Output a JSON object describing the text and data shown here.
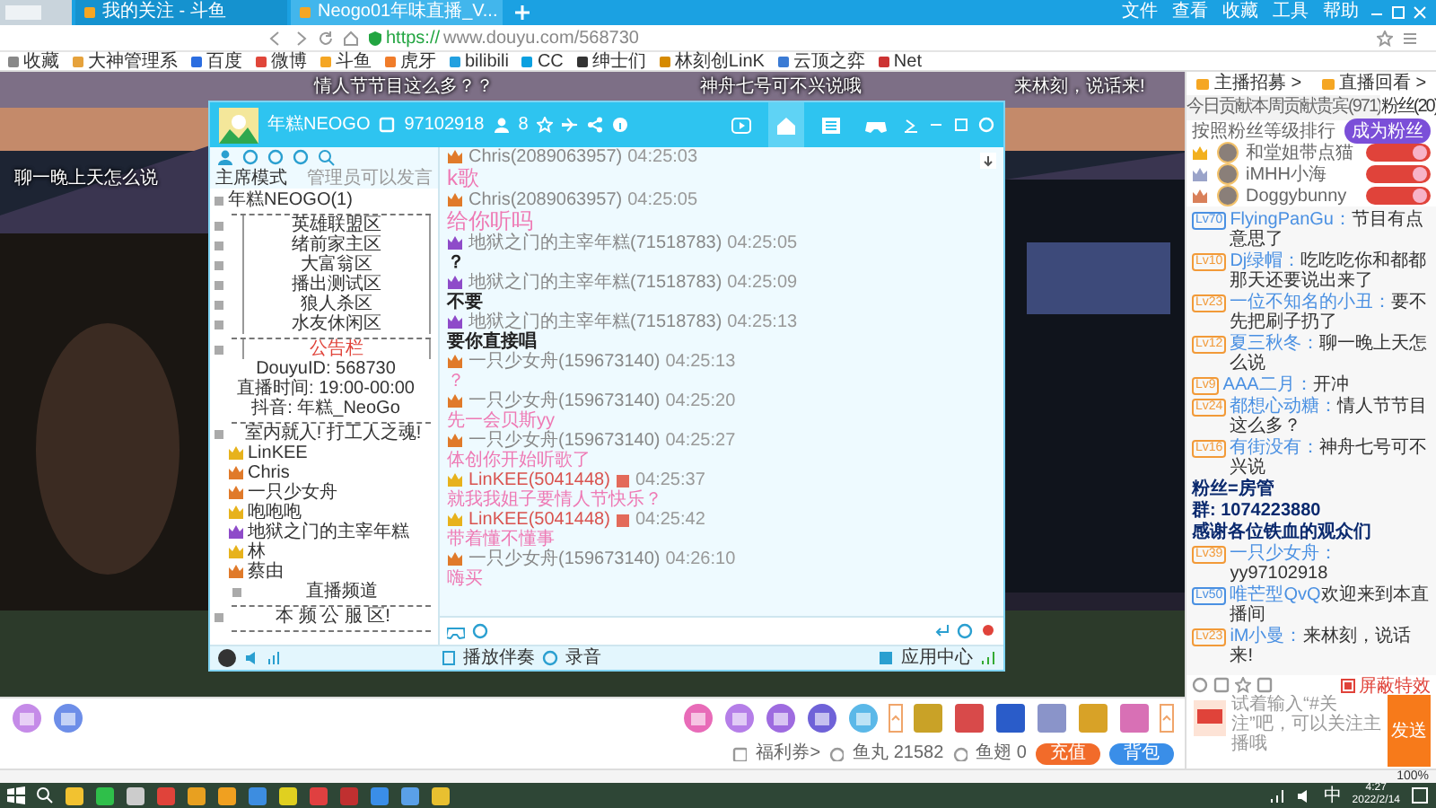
{
  "browser": {
    "tabs": [
      {
        "label": "我的关注 - 斗鱼",
        "selected": false
      },
      {
        "label": "Neogo01年味直播_V...",
        "selected": true
      }
    ],
    "menu": [
      "文件",
      "查看",
      "收藏",
      "工具",
      "帮助"
    ],
    "url_scheme": "https://",
    "url_rest": "www.douyu.com/568730",
    "bookmarks": [
      "收藏",
      "大神管理系",
      "百度",
      "微博",
      "斗鱼",
      "虎牙",
      "bilibili",
      "CC",
      "绅士们",
      "林刻创LinK",
      "云顶之弈",
      "Net"
    ]
  },
  "video": {
    "kind": "picture",
    "danmaku": [
      "情人节节目这么多？？",
      "神舟七号可不兴说哦",
      "来林刻，说话来!",
      "聊一晚上天怎么说"
    ]
  },
  "chat_app": {
    "title": "年糕NEOGO",
    "channel_id": "97102918",
    "online": "8",
    "mode": "主席模式",
    "notice": "管理员可以发言",
    "channels": [
      {
        "kind": "root",
        "label": "年糕NEOGO(1)"
      },
      {
        "kind": "divider"
      },
      {
        "kind": "room",
        "label": "英雄联盟区"
      },
      {
        "kind": "room",
        "label": "绪前家主区"
      },
      {
        "kind": "room",
        "label": "大富翁区"
      },
      {
        "kind": "room",
        "label": "播出测试区"
      },
      {
        "kind": "room",
        "label": "狼人杀区"
      },
      {
        "kind": "room",
        "label": "水友休闲区"
      },
      {
        "kind": "divider"
      },
      {
        "kind": "notice",
        "label": "公告栏"
      },
      {
        "kind": "info",
        "label": "DouyuID: 568730"
      },
      {
        "kind": "info",
        "label": "直播时间: 19:00-00:00"
      },
      {
        "kind": "info",
        "label": "抖音: 年糕_NeoGo"
      },
      {
        "kind": "divider"
      },
      {
        "kind": "title",
        "label": "室内就人! 打工人之魂!"
      },
      {
        "kind": "user",
        "label": "LinKEE",
        "color": "#e7b21c"
      },
      {
        "kind": "user",
        "label": "Chris",
        "color": "#e07a2a"
      },
      {
        "kind": "user",
        "label": "一只少女舟",
        "color": "#e07a2a"
      },
      {
        "kind": "user",
        "label": "咆咆咆",
        "color": "#e7b21c"
      },
      {
        "kind": "user",
        "label": "地狱之门的主宰年糕",
        "color": "#8e4bc9"
      },
      {
        "kind": "user",
        "label": "林",
        "color": "#e7b21c"
      },
      {
        "kind": "user",
        "label": "蔡由",
        "color": "#e07a2a"
      },
      {
        "kind": "channel",
        "label": "直播频道"
      },
      {
        "kind": "divider"
      },
      {
        "kind": "title",
        "label": "本 频 公 服 区!"
      },
      {
        "kind": "divider"
      }
    ],
    "messages": [
      {
        "user": "Chris(2089063957)",
        "time": "04:25:03",
        "text": "k歌",
        "kind": "big",
        "color": "#e07a2a",
        "vip": false
      },
      {
        "user": "Chris(2089063957)",
        "time": "04:25:05",
        "text": "给你听吗",
        "kind": "big",
        "color": "#e07a2a",
        "vip": false
      },
      {
        "user": "地狱之门的主宰年糕(71518783)",
        "time": "04:25:05",
        "text": "？",
        "kind": "bold",
        "color": "#8e4bc9",
        "vip": false
      },
      {
        "user": "地狱之门的主宰年糕(71518783)",
        "time": "04:25:09",
        "text": "不要",
        "kind": "bold",
        "color": "#8e4bc9",
        "vip": false
      },
      {
        "user": "地狱之门的主宰年糕(71518783)",
        "time": "04:25:13",
        "text": "要你直接唱",
        "kind": "bold",
        "color": "#8e4bc9",
        "vip": false
      },
      {
        "user": "一只少女舟(159673140)",
        "time": "04:25:13",
        "text": "？",
        "kind": "small",
        "color": "#e07a2a",
        "vip": false
      },
      {
        "user": "一只少女舟(159673140)",
        "time": "04:25:20",
        "text": "先一会贝斯yy",
        "kind": "small",
        "color": "#e07a2a",
        "vip": false
      },
      {
        "user": "一只少女舟(159673140)",
        "time": "04:25:27",
        "text": "体创你开始听歌了",
        "kind": "small",
        "color": "#e07a2a",
        "vip": false
      },
      {
        "user": "LinKEE(5041448)",
        "time": "04:25:37",
        "text": "就我我姐子要情人节快乐？",
        "kind": "small",
        "color": "#e7b21c",
        "vip": true
      },
      {
        "user": "LinKEE(5041448)",
        "time": "04:25:42",
        "text": "带着懂不懂事",
        "kind": "small",
        "color": "#e7b21c",
        "vip": true
      },
      {
        "user": "一只少女舟(159673140)",
        "time": "04:26:10",
        "text": "嗨买",
        "kind": "small",
        "color": "#e07a2a",
        "vip": false
      }
    ],
    "footer": [
      "播放伴奏",
      "录音",
      "应用中心"
    ]
  },
  "sidebar": {
    "links": [
      "主播招募 >",
      "直播回看 >"
    ],
    "tabs": [
      {
        "label": "今日贡献",
        "selected": false
      },
      {
        "label": "本周贡献",
        "selected": false
      },
      {
        "label": "贵宾(971)",
        "selected": false
      },
      {
        "label": "粉丝(20)",
        "selected": true
      }
    ],
    "rank_title": "按照粉丝等级排行",
    "join_button": "成为粉丝",
    "fans": [
      {
        "name": "和堂姐带点猫",
        "color": "#f2b01e"
      },
      {
        "name": "iMHH小海",
        "color": "#9aa3c9"
      },
      {
        "name": "Doggybunny",
        "color": "#d9805a"
      }
    ],
    "messages": [
      {
        "level": "Lv70",
        "color": "#4a90e2",
        "name": "FlyingPanGu：",
        "text": "节目有点意思了"
      },
      {
        "level": "Lv10",
        "color": "#f29a38",
        "name": "Dj绿帽：",
        "text": "吃吃吃你和都都那天还要说出来了"
      },
      {
        "level": "Lv23",
        "color": "#f29a38",
        "name": "一位不知名的小丑：",
        "text": "要不先把刷子扔了"
      },
      {
        "level": "Lv12",
        "color": "#f29a38",
        "name": "夏三秋冬：",
        "text": "聊一晚上天怎么说"
      },
      {
        "level": "Lv9",
        "color": "#f29a38",
        "name": "AAA二月：",
        "text": "开冲"
      },
      {
        "level": "Lv24",
        "color": "#f29a38",
        "name": "都想心动糖：",
        "text": "情人节节目这么多？"
      },
      {
        "level": "Lv16",
        "color": "#f29a38",
        "name": "有街没有：",
        "text": "神舟七号可不兴说"
      },
      {
        "level": "Lv39",
        "color": "#f29a38",
        "name": "一只少女舟：",
        "text": "yy97102918"
      },
      {
        "level": "Lv50",
        "color": "#4a90e2",
        "name": "唯芒型QvQ",
        "text": "欢迎来到本直播间"
      },
      {
        "level": "Lv23",
        "color": "#f29a38",
        "name": "iM小曼：",
        "text": "来林刻，说话来!"
      }
    ],
    "overlay_lines": [
      "粉丝=房管",
      "群: 1074223880",
      "感谢各位铁血的观众们"
    ],
    "block_effects": true,
    "block_effects_label": "屏蔽特效",
    "input": {
      "placeholder": "试着输入“#关注”吧，可以关注主播哦"
    },
    "send_button": "发送"
  },
  "gift_bar": {
    "coupon": "福利券>",
    "fish_balls": "鱼丸 21582",
    "fins": "鱼翅 0",
    "recharge": "充值",
    "backpack": "背包"
  },
  "status_bar": {
    "zoom": "100%"
  },
  "taskbar": {
    "ime": "中",
    "time": "4:27",
    "date": "2022/2/14"
  }
}
